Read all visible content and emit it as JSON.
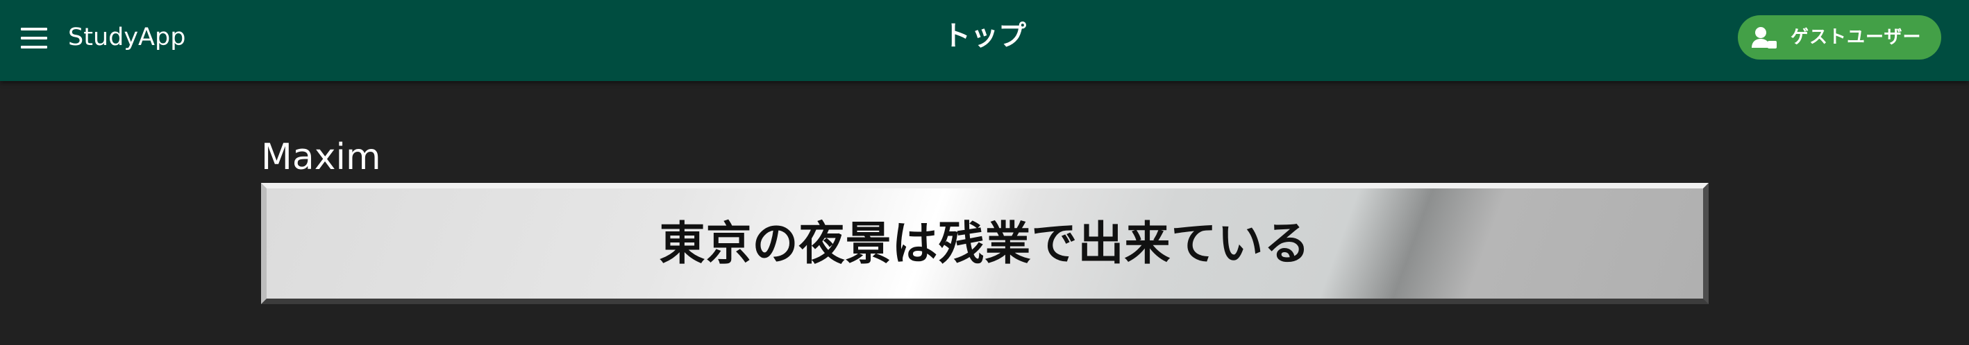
{
  "app_bar": {
    "app_name": "StudyApp",
    "page_title": "トップ",
    "user_button_label": "ゲストユーザー",
    "menu_icon": "hamburger-menu-icon",
    "user_icon": "person-icon",
    "background_color": "#004d40",
    "user_button_color": "#43a047"
  },
  "main": {
    "maxim_author": "Maxim",
    "maxim_text": "東京の夜景は残業で出来ている",
    "background_color": "#212121"
  }
}
